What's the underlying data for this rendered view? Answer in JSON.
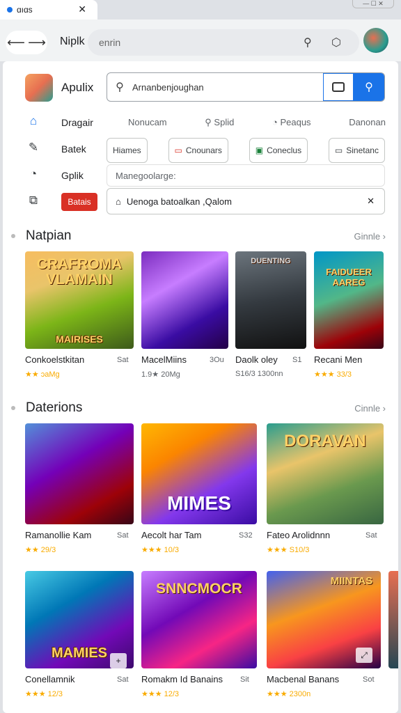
{
  "tab": {
    "title": "ɑıɑs"
  },
  "window": {
    "controls": "— ☐ ✕"
  },
  "toolbar": {
    "site_label": "Niplk",
    "address_value": "enrin"
  },
  "app": {
    "title": "Apulix"
  },
  "search": {
    "value": "Arnanbenjoughan"
  },
  "sidebar": {
    "items": [
      {
        "label": "Dragair",
        "icon": "home-icon"
      },
      {
        "label": "Batek",
        "icon": "store-icon"
      },
      {
        "label": "Gplik",
        "icon": "clock-icon"
      },
      {
        "label": "",
        "icon": "puzzle-icon"
      }
    ]
  },
  "nav_links": [
    "Nonucam",
    "Splid",
    "Peaqus",
    "Danonan"
  ],
  "chips": [
    {
      "label": "Hiames",
      "icon": ""
    },
    {
      "label": "Cnounars",
      "icon": "▭"
    },
    {
      "label": "Coneclus",
      "icon": "▣"
    },
    {
      "label": "Sinetanc",
      "icon": "▭"
    }
  ],
  "field1": {
    "value": "Manegoolarge:"
  },
  "badge": {
    "label": "Batais"
  },
  "field2": {
    "value": "Uenoga batoalkan ,Qalom"
  },
  "sections": [
    {
      "title": "Natpian",
      "more": "Ginnle ›"
    },
    {
      "title": "Daterions",
      "more": "Cinnle ›"
    }
  ],
  "row1": [
    {
      "title": "Conkoelstkitan",
      "size": "Sat",
      "meta": "★★ ɔaMg",
      "art": "CRAFROMA VLAMAIN",
      "art2": "MAIRISES"
    },
    {
      "title": "MacelMiins",
      "size": "3Ou",
      "meta": "1.9★ 20Mg",
      "art": "",
      "art2": ""
    },
    {
      "title": "Daolk oley",
      "size": "S1",
      "meta": "S16/3 1300nn",
      "art": "DUENTING",
      "art2": ""
    },
    {
      "title": "Recani Men",
      "size": "",
      "meta": "★★★ 33/3",
      "art": "FAIDUEER AAREG",
      "art2": ""
    }
  ],
  "row2": [
    {
      "title": "Ramanollie Kam",
      "size": "Sat",
      "meta": "★★ 29/3",
      "art": ""
    },
    {
      "title": "Aecolt har Tam",
      "size": "S32",
      "meta": "★★★ 10/3",
      "art": "MIMES"
    },
    {
      "title": "Fateo Arolidnnn",
      "size": "Sat",
      "meta": "★★★ S10/3",
      "art": "DORAVAN"
    }
  ],
  "row3": [
    {
      "title": "Conellamnik",
      "size": "Sat",
      "meta": "★★★ 12/3",
      "art": "MAMIES"
    },
    {
      "title": "Romakm Id Banains",
      "size": "Sit",
      "meta": "★★★ 12/3",
      "art": "SNNCMOCR"
    },
    {
      "title": "Macbenal Banans",
      "size": "Sot",
      "meta": "★★★ 2300n",
      "art": "MIINTAS"
    }
  ],
  "colors": {
    "accent": "#1a73e8",
    "badge": "#d93025",
    "star": "#f9ab00"
  }
}
